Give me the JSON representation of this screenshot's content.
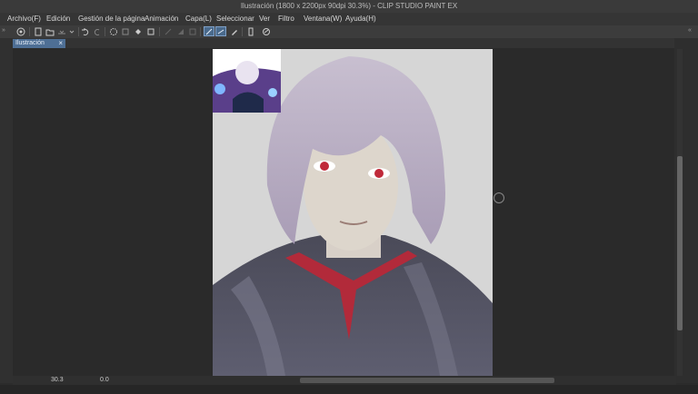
{
  "window": {
    "title": "Ilustración (1800 x 2200px 90dpi 30.3%)  - CLIP STUDIO PAINT EX"
  },
  "menu": [
    "Archivo(F)",
    "Edición",
    "Gestión de la página",
    "Animación",
    "Capa(L)",
    "Seleccionar",
    "Ver",
    "Filtro",
    "Ventana(W)",
    "Ayuda(H)"
  ],
  "tab": {
    "label": "Ilustración",
    "close": "×"
  },
  "status": {
    "zoom": "30.3",
    "rotation": "0.0"
  },
  "colors": {
    "accent": "#4e6f95",
    "background": "#2b2b2b",
    "canvas_bg": "#d4d4d4"
  },
  "icons": [
    "navigator-icon",
    "new-icon",
    "open-icon",
    "save-icon",
    "undo-icon",
    "redo-icon",
    "lasso-icon",
    "clear-icon",
    "fill-icon",
    "crop-icon",
    "snap-icon",
    "transform-icon",
    "pen-icon",
    "ruler-icon",
    "brush-icon",
    "page-icon",
    "link-icon"
  ]
}
